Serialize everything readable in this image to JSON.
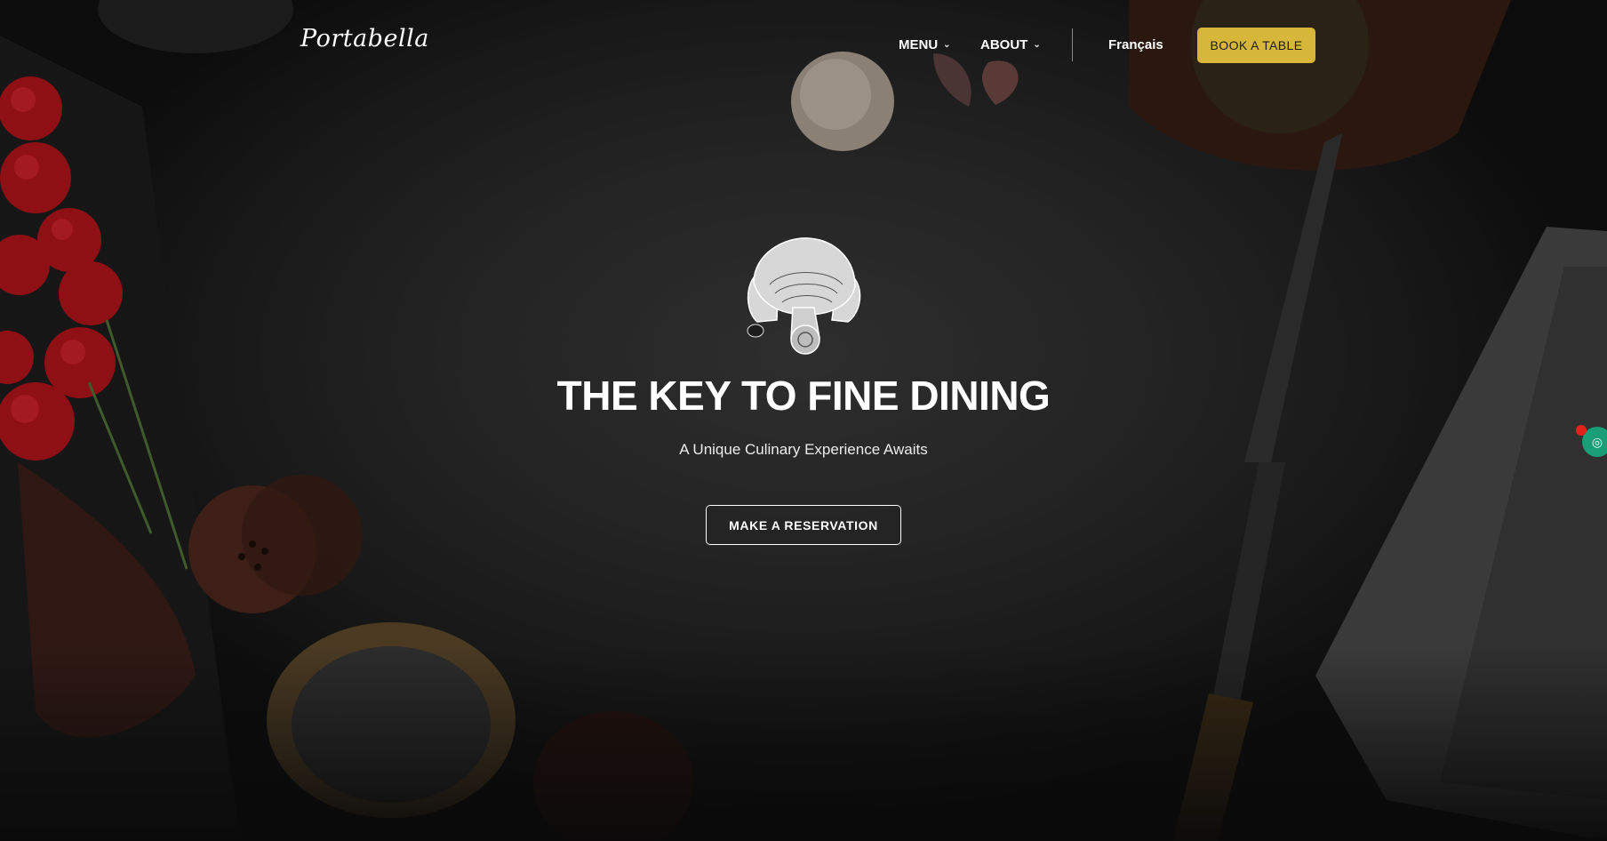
{
  "header": {
    "logo_text": "Portabella",
    "nav": [
      {
        "label": "MENU",
        "has_dropdown": true
      },
      {
        "label": "ABOUT",
        "has_dropdown": true
      }
    ],
    "language_label": "Français",
    "book_button_label": "BOOK A TABLE"
  },
  "hero": {
    "emblem_icon": "mushroom-emblem-icon",
    "title": "THE KEY TO FINE DINING",
    "subtitle": "A Unique Culinary Experience Awaits",
    "cta_label": "MAKE A RESERVATION"
  },
  "widget": {
    "icon": "accessibility-widget-icon"
  },
  "colors": {
    "background": "#1e1e1e",
    "accent_gold": "#d7b73a",
    "text": "#ffffff",
    "widget_green": "#1a9e78",
    "widget_dot_red": "#e0241c"
  }
}
